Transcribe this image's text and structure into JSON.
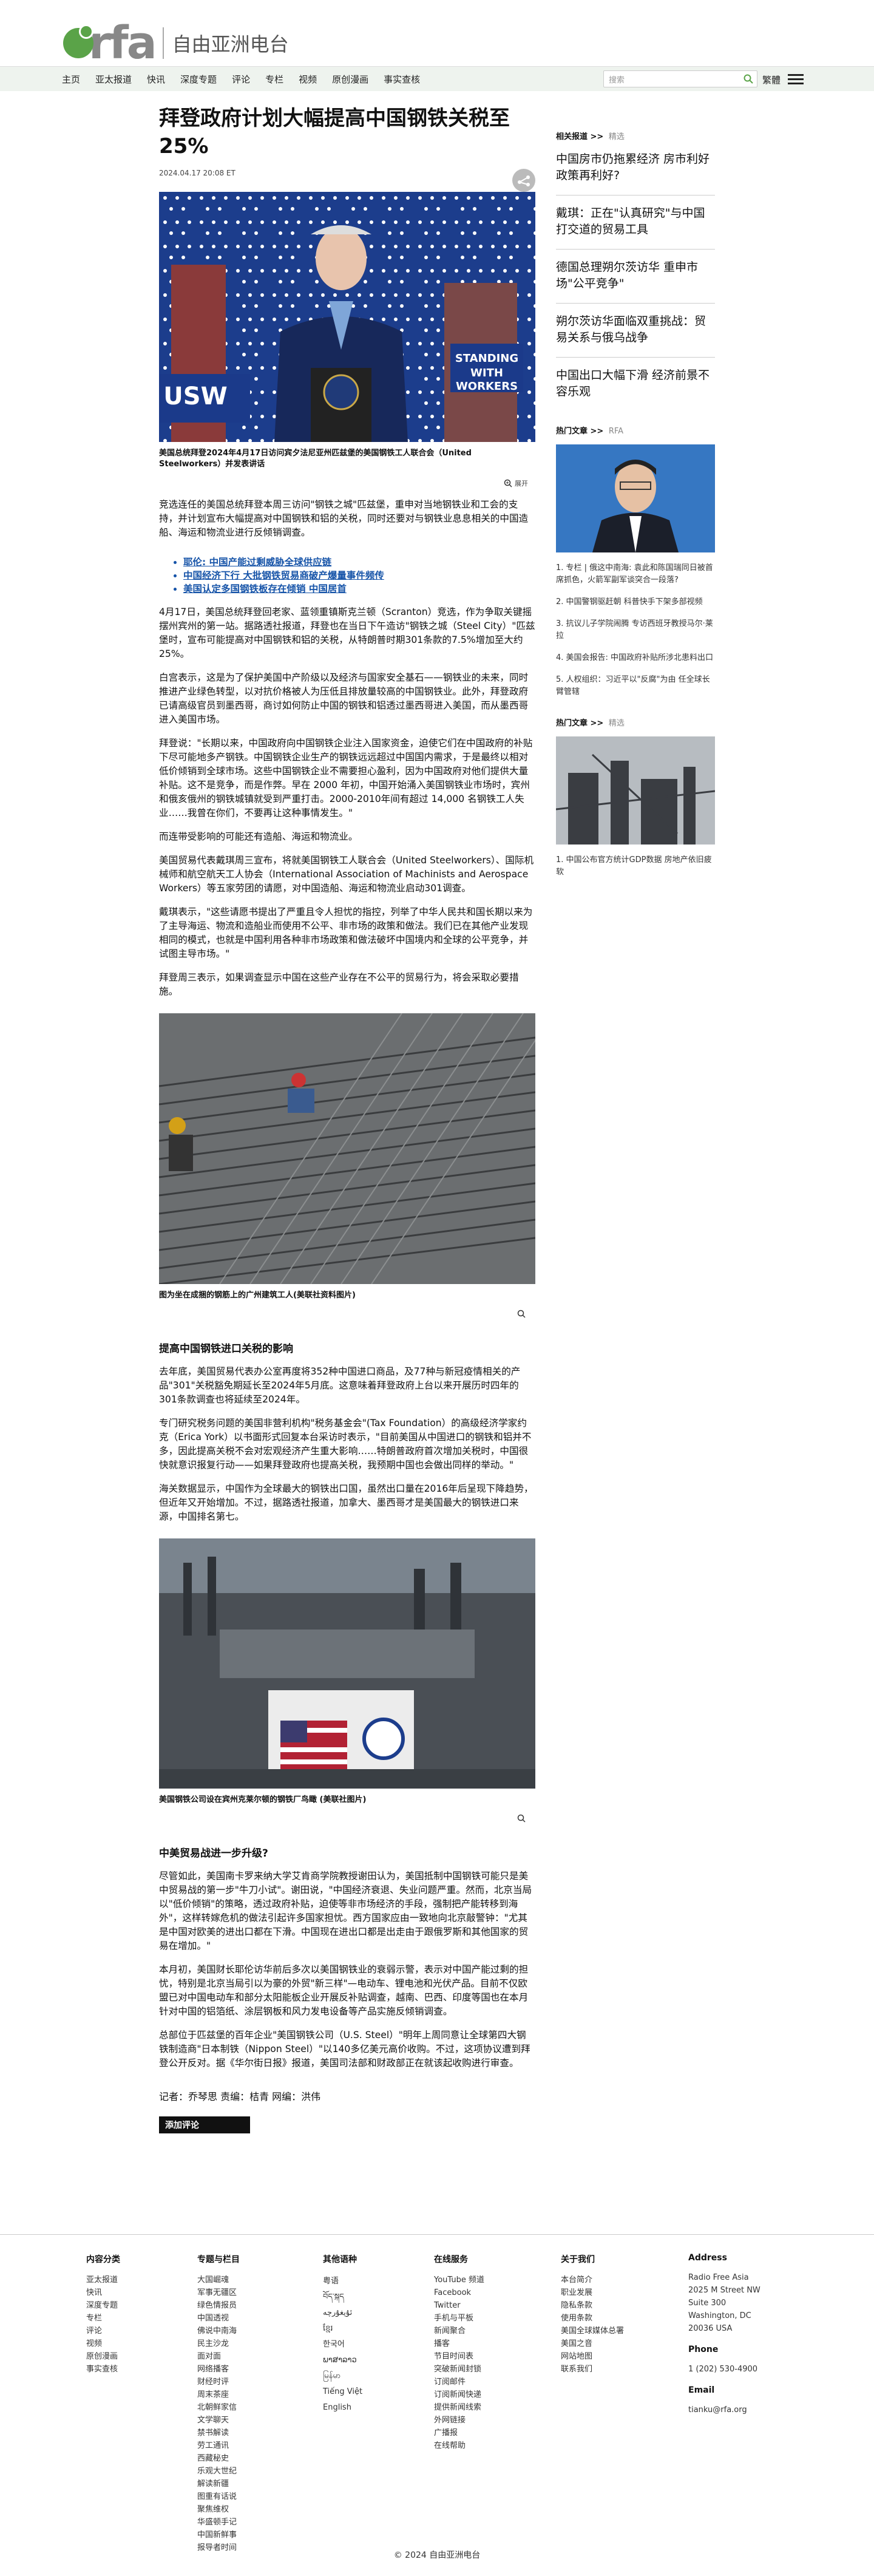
{
  "header": {
    "logo_text": "rfa",
    "logo_sub": "自由亚洲电台",
    "nav": [
      "主页",
      "亚太报道",
      "快讯",
      "深度专题",
      "评论",
      "专栏",
      "视频",
      "原创漫画",
      "事实查核"
    ],
    "search_placeholder": "搜索",
    "lang": "繁體"
  },
  "article": {
    "title": "拜登政府计划大幅提高中国钢铁关税至25%",
    "date": "2024.04.17 20:08 ET",
    "fig1_caption": "美国总统拜登2024年4月17日访问宾夕法尼亚州匹兹堡的美国钢铁工人联合会（United Steelworkers）并发表讲话",
    "zoom_label": "展开",
    "p1": "竞选连任的美国总统拜登本周三访问\"钢铁之城\"匹兹堡，重申对当地钢铁业和工会的支持，并计划宣布大幅提高对中国钢铁和铝的关税，同时还要对与钢铁业息息相关的中国造船、海运和物流业进行反倾销调查。",
    "related": [
      "耶伦: 中国产能过剩威胁全球供应链",
      "中国经济下行  大批钢铁贸易商破产爆量事件频传",
      "美国认定多国钢铁板存在倾销 中国居首"
    ],
    "p2": "4月17日，美国总统拜登回老家、蓝领重镇斯克兰顿（Scranton）竞选，作为争取关键摇摆州宾州的第一站。据路透社报道，拜登也在当日下午造访\"钢铁之城（Steel City）\"匹兹堡时，宣布可能提高对中国钢铁和铝的关税，从特朗普时期301条款的7.5%增加至大约25%。",
    "p3": "白宫表示，这是为了保护美国中产阶级以及经济与国家安全基石——钢铁业的未来，同时推进产业绿色转型，以对抗价格被人为压低且排放量较高的中国钢铁业。此外，拜登政府已请高级官员到墨西哥，商讨如何防止中国的钢铁和铝透过墨西哥进入美国，而从墨西哥进入美国市场。",
    "p4": "拜登说：\"长期以来，中国政府向中国钢铁企业注入国家资金，迫使它们在中国政府的补贴下尽可能地多产钢铁。中国钢铁企业生产的钢铁远远超过中国国内需求，于是最终以相对低价倾销到全球市场。这些中国钢铁企业不需要担心盈利，因为中国政府对他们提供大量补贴。这不是竞争，而是作弊。早在 2000 年初，中国开始涌入美国钢铁业市场时，宾州和俄亥俄州的钢铁城镇就受到严重打击。2000-2010年间有超过 14,000 名钢铁工人失业……我曾在你们，不要再让这种事情发生。\"",
    "p5": "而连带受影响的可能还有造船、海运和物流业。",
    "p6": "美国贸易代表戴琪周三宣布，将就美国钢铁工人联合会（United Steelworkers）、国际机械师和航空航天工人协会（International Association of Machinists and Aerospace Workers）等五家劳团的请愿，对中国造船、海运和物流业启动301调查。",
    "p7": "戴琪表示，\"这些请愿书提出了严重且令人担忧的指控，列举了中华人民共和国长期以来为了主导海运、物流和造船业而使用不公平、非市场的政策和做法。我们已在其他产业发现相同的模式，也就是中国利用各种非市场政策和做法破坏中国境内和全球的公平竞争，并试图主导市场。\"",
    "p8": "拜登周三表示，如果调查显示中国在这些产业存在不公平的贸易行为，将会采取必要措施。",
    "fig2_caption": "图为坐在成捆的钢筋上的广州建筑工人(美联社资料图片)",
    "h_impact": "提高中国钢铁进口关税的影响",
    "p9": "去年底，美国贸易代表办公室再度将352种中国进口商品，及77种与新冠疫情相关的产品\"301\"关税豁免期延长至2024年5月底。这意味着拜登政府上台以来开展历时四年的301条款调查也将延续至2024年。",
    "p10": "专门研究税务问题的美国非营利机构\"税务基金会\"(Tax Foundation）的高级经济学家约克（Erica York）以书面形式回复本台采访时表示，\"目前美国从中国进口的钢铁和铝并不多，因此提高关税不会对宏观经济产生重大影响……特朗普政府首次增加关税时，中国很快就意识报复行动——如果拜登政府也提高关税，我预期中国也会做出同样的举动。\"",
    "p11": "海关数据显示，中国作为全球最大的钢铁出口国，虽然出口量在2016年后呈现下降趋势，但近年又开始增加。不过，据路透社报道，加拿大、墨西哥才是美国最大的钢铁进口来源，中国排名第七。",
    "fig3_caption": "美国钢铁公司设在宾州克莱尔顿的钢铁厂鸟瞰 (美联社图片)",
    "h_war": "中美贸易战进一步升级?",
    "p12": "尽管如此，美国南卡罗来纳大学艾肯商学院教授谢田认为，美国抵制中国钢铁可能只是美中贸易战的第一步\"牛刀小试\"。谢田说，\"中国经济衰退、失业问题严重。然而，北京当局以\"低价倾销\"的策略，透过政府补贴，迫使等非市场经济的手段，强制把产能转移到海外\"，这样转嫁危机的做法引起许多国家担忧。西方国家应由一致地向北京敲警钟：\"尤其是中国对欧美的进出口都在下滑。中国现在进出口都是出走由于跟俄罗斯和其他国家的贸易在增加。\"",
    "p13": "本月初，美国财长耶伦访华前后多次以美国钢铁业的衰弱示警，表示对中国产能过剩的担忧，特别是北京当局引以为豪的外贸\"新三样\"—电动车、锂电池和光伏产品。目前不仅欧盟已对中国电动车和部分太阳能板企业开展反补贴调查，越南、巴西、印度等国也在本月针对中国的铝箔纸、涂层钢板和风力发电设备等产品实施反倾销调查。",
    "p14": "总部位于匹兹堡的百年企业\"美国钢铁公司（U.S. Steel）\"明年上周同意让全球第四大钢铁制造商\"日本制铁（Nippon Steel）\"以140多亿美元高价收购。不过，这项协议遭到拜登公开反对。据《华尔街日报》报道，美国司法部和财政部正在就该起收购进行审查。",
    "credits": "记者：乔琴思  责编：桔青  网编：洪伟",
    "comment_btn": "添加评论"
  },
  "sidebar": {
    "related_head": "相关报道 >>",
    "related_sub": "精选",
    "headlines": [
      "中国房市仍拖累经济  房市利好政策再利好?",
      "戴琪：正在\"认真研究\"与中国打交道的贸易工具",
      "德国总理朔尔茨访华  重申市场\"公平竞争\"",
      "朔尔茨访华面临双重挑战：贸易关系与俄乌战争",
      "中国出口大幅下滑  经济前景不容乐观"
    ],
    "popular_head": "热门文章 >>",
    "popular_sub": "RFA",
    "popular": [
      "1. 专栏 | 俄这中南海: 袁此和陈国瑞同日被首席抓色，火箭军副军谈突合一段落?",
      "2. 中国警钢驱赶朝  科普快手下架多部视频",
      "3. 抗议儿子学院闹腾  专访西班牙教授马尔·莱拉",
      "4. 美国会报告: 中国政府补贴所涉北患料出口",
      "5. 人权组织：习近平以\"反腐\"为由 任全球长臂管辖"
    ],
    "popular2_head": "热门文章 >>",
    "popular2_sub": "精选",
    "popular2": [
      "1. 中国公布官方统计GDP数据  房地产依旧疲软"
    ]
  },
  "footer": {
    "col1_title": "内容分类",
    "col1": [
      "亚太报道",
      "快讯",
      "深度专题",
      "专栏",
      "评论",
      "视频",
      "原创漫画",
      "事实查核"
    ],
    "col2_title": "专题与栏目",
    "col2": [
      "大国崛魂",
      "军事无疆区",
      "绿色情报员",
      "中国透视",
      "佛说中南海",
      "民主沙龙",
      "面对面",
      "网络播客",
      "财经时评",
      "周末茶座",
      "北朝鲜家信",
      "文学聊天",
      "禁书解读",
      "劳工通讯",
      "西藏秘史",
      "乐观大世纪",
      "解读新疆",
      "图重有话说",
      "聚焦维权",
      "华盛顿手记",
      "中国新鲜事",
      "报导者时间"
    ],
    "col3_title": "其他语种",
    "col3": [
      "粤语",
      "བོད་སྐད",
      "ئۇيغۇرچە",
      "ខ្មែរ",
      "한국어",
      "ພາສາລາວ",
      "မြန်မာ",
      "Tiếng Việt",
      "English"
    ],
    "col4_title": "在线服务",
    "col4": [
      "YouTube 频道",
      "Facebook",
      "Twitter",
      "手机与平板",
      "新闻聚合",
      "播客",
      "节目时间表",
      "突破新闻封锁",
      "订阅邮件",
      "订阅新闻快递",
      "提供新闻线索",
      "外网链接",
      "广播报",
      "在线帮助"
    ],
    "col5_title": "关于我们",
    "col5": [
      "本台简介",
      "职业发展",
      "隐私条款",
      "使用条款",
      "美国全球媒体总署",
      "美国之音",
      "网站地图",
      "联系我们"
    ],
    "col6_title": "Address",
    "address": [
      "Radio Free Asia",
      "2025 M Street NW",
      "Suite 300",
      "Washington, DC",
      "20036 USA"
    ],
    "phone_title": "Phone",
    "phone": "1 (202) 530-4900",
    "email_title": "Email",
    "email": "tianku@rfa.org",
    "copyright": "© 2024 自由亚洲电台"
  }
}
